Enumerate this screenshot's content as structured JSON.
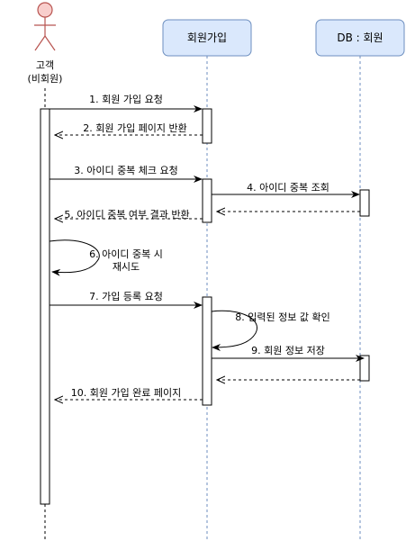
{
  "diagram": {
    "actor": {
      "line1": "고객",
      "line2": "(비회원)"
    },
    "participants": [
      {
        "label": "회원가입"
      },
      {
        "label": "DB : 회원"
      }
    ],
    "messages": [
      {
        "label": "1. 회원 가입 요청"
      },
      {
        "label": "2. 회원 가입 페이지 반환"
      },
      {
        "label": "3. 아이디 중복 체크 요청"
      },
      {
        "label": "4. 아이디 중복 조회"
      },
      {
        "label": "5. 아이디 중복 여부 결과 반환"
      },
      {
        "label_line1": "6. 아이디 중복 시",
        "label_line2": "재시도"
      },
      {
        "label": "7. 가입 등록 요청"
      },
      {
        "label": "8. 입력된 정보 값 확인"
      },
      {
        "label": "9. 회원 정보 저장"
      },
      {
        "label": "10. 회원 가입 완료 페이지"
      }
    ]
  }
}
